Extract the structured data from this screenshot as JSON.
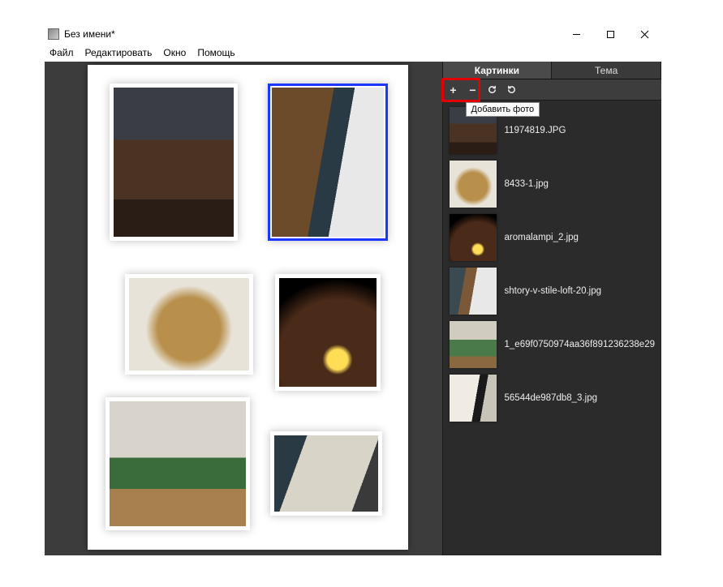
{
  "window": {
    "title": "Без имени*"
  },
  "menu": {
    "file": "Файл",
    "edit": "Редактировать",
    "window": "Окно",
    "help": "Помощь"
  },
  "tabs": {
    "pictures": "Картинки",
    "theme": "Тема"
  },
  "toolbar": {
    "tooltip_add": "Добавить фото"
  },
  "files": [
    {
      "name": "11974819.JPG"
    },
    {
      "name": "8433-1.jpg"
    },
    {
      "name": "aromalampi_2.jpg"
    },
    {
      "name": "shtory-v-stile-loft-20.jpg"
    },
    {
      "name": "1_e69f0750974aa36f891236238e29"
    },
    {
      "name": "56544de987db8_3.jpg"
    }
  ]
}
